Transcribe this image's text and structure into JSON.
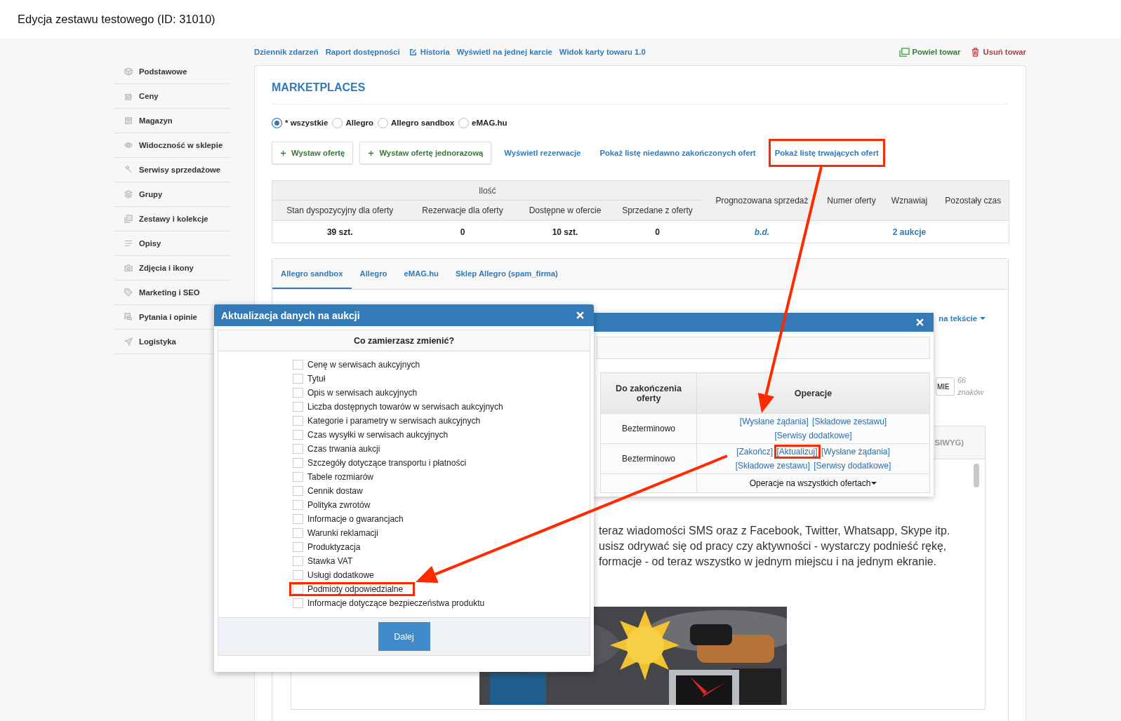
{
  "page": {
    "title": "Edycja zestawu testowego (ID: 31010)"
  },
  "sidebar": {
    "items": [
      {
        "label": "Podstawowe"
      },
      {
        "label": "Ceny"
      },
      {
        "label": "Magazyn"
      },
      {
        "label": "Widoczność w sklepie"
      },
      {
        "label": "Serwisy sprzedażowe"
      },
      {
        "label": "Grupy"
      },
      {
        "label": "Zestawy i kolekcje"
      },
      {
        "label": "Opisy"
      },
      {
        "label": "Zdjęcia i ikony"
      },
      {
        "label": "Marketing i SEO"
      },
      {
        "label": "Pytania i opinie"
      },
      {
        "label": "Logistyka"
      }
    ]
  },
  "top_links": [
    {
      "label": "Dziennik zdarzeń",
      "kind": "plain"
    },
    {
      "label": "Raport dostępności",
      "kind": "plain"
    },
    {
      "label": "Historia",
      "kind": "edit"
    },
    {
      "label": "Wyświetl na jednej karcie",
      "kind": "plain"
    },
    {
      "label": "Widok karty towaru 1.0",
      "kind": "plain"
    }
  ],
  "actions": [
    {
      "label": "Powiel towar",
      "kind": "copy"
    },
    {
      "label": "Usuń towar",
      "kind": "delete"
    }
  ],
  "marketplaces": {
    "heading": "MARKETPLACES",
    "filters": [
      {
        "label": "* wszystkie",
        "selected": true
      },
      {
        "label": "Allegro",
        "selected": false
      },
      {
        "label": "Allegro sandbox",
        "selected": false
      },
      {
        "label": "eMAG.hu",
        "selected": false
      }
    ],
    "buttons": [
      "Wystaw ofertę",
      "Wystaw ofertę jednorazową"
    ],
    "links": [
      {
        "label": "Wyświetl rezerwacje",
        "highlighted": false
      },
      {
        "label": "Pokaż listę niedawno zakończonych ofert",
        "highlighted": false
      },
      {
        "label": "Pokaż listę trwających ofert",
        "highlighted": true
      }
    ]
  },
  "stock_table": {
    "group": {
      "label": "Ilość",
      "columns": [
        {
          "header": "Stan dyspozycyjny dla oferty",
          "value": "39 szt.",
          "kind": "quantity"
        },
        {
          "header": "Rezerwacje dla oferty",
          "value": "0",
          "kind": "quantity"
        },
        {
          "header": "Dostępne w ofercie",
          "value": "10 szt.",
          "kind": "quantity"
        },
        {
          "header": "Sprzedane z oferty",
          "value": "0",
          "kind": "quantity"
        }
      ]
    },
    "columns": [
      {
        "header": "Prognozowana sprzedaż",
        "value": "b.d.",
        "kind": "estimate"
      },
      {
        "header": "Numer oferty"
      },
      {
        "header": "Wznawiaj",
        "value": "2 aukcje",
        "kind": "link"
      },
      {
        "header": "Pozostały czas"
      }
    ]
  },
  "tabs": [
    {
      "label": "Allegro sandbox",
      "selected": true
    },
    {
      "label": "Allegro",
      "selected": false
    },
    {
      "label": "eMAG.hu",
      "selected": false
    },
    {
      "label": "Sklep Allegro (spam_firma)",
      "selected": false
    }
  ],
  "editor": {
    "toggle": "na tekście",
    "name_field": "MIE",
    "counter": "66 znaków",
    "mode_tab": "SIWYG)",
    "paragraph": [
      "teraz wiadomości SMS oraz z Facebook, Twitter, Whatsapp, Skype itp.",
      "usisz odrywać się od pracy czy aktywności - wystarczy podnieść rękę,",
      "formacje - od teraz wszystko w jednym miejscu i na jednym ekranie."
    ],
    "image": {
      "kind": "picture"
    }
  },
  "offers_dialog": {
    "columns": [
      "Do zakończenia oferty",
      "Operacje"
    ],
    "rows": [
      {
        "end": "Bezterminowo",
        "operations": [
          {
            "label": "[Wysłane żądania]",
            "highlighted": false
          },
          {
            "label": "[Składowe zestawu]",
            "highlighted": false
          },
          {
            "label": "[Serwisy dodatkowe]",
            "highlighted": false
          }
        ]
      },
      {
        "end": "Bezterminowo",
        "operations": [
          {
            "label": "[Zakończ]",
            "highlighted": false
          },
          {
            "label": "[Aktualizuj]",
            "highlighted": true
          },
          {
            "label": "[Wysłane żądania]",
            "highlighted": false
          },
          {
            "label": "[Składowe zestawu]",
            "highlighted": false
          },
          {
            "label": "[Serwisy dodatkowe]",
            "highlighted": false
          }
        ]
      }
    ],
    "bulk": "Operacje na wszystkich ofertach"
  },
  "update_dialog": {
    "title": "Aktualizacja danych na aukcji",
    "question": "Co zamierzasz zmienić?",
    "options": [
      {
        "label": "Cenę w serwisach aukcyjnych",
        "checked": false,
        "highlighted": false
      },
      {
        "label": "Tytuł",
        "checked": false,
        "highlighted": false
      },
      {
        "label": "Opis w serwisach aukcyjnych",
        "checked": false,
        "highlighted": false
      },
      {
        "label": "Liczba dostępnych towarów w serwisach aukcyjnych",
        "checked": false,
        "highlighted": false
      },
      {
        "label": "Kategorie i parametry w serwisach aukcyjnych",
        "checked": false,
        "highlighted": false
      },
      {
        "label": "Czas wysyłki w serwisach aukcyjnych",
        "checked": false,
        "highlighted": false
      },
      {
        "label": "Czas trwania aukcji",
        "checked": false,
        "highlighted": false
      },
      {
        "label": "Szczegóły dotyczące transportu i płatności",
        "checked": false,
        "highlighted": false
      },
      {
        "label": "Tabele rozmiarów",
        "checked": false,
        "highlighted": false
      },
      {
        "label": "Cennik dostaw",
        "checked": false,
        "highlighted": false
      },
      {
        "label": "Polityka zwrotów",
        "checked": false,
        "highlighted": false
      },
      {
        "label": "Informacje o gwarancjach",
        "checked": false,
        "highlighted": false
      },
      {
        "label": "Warunki reklamacji",
        "checked": false,
        "highlighted": false
      },
      {
        "label": "Produktyzacja",
        "checked": false,
        "highlighted": false
      },
      {
        "label": "Stawka VAT",
        "checked": false,
        "highlighted": false
      },
      {
        "label": "Usługi dodatkowe",
        "checked": false,
        "highlighted": false
      },
      {
        "label": "Podmioty odpowiedzialne",
        "checked": false,
        "highlighted": true
      },
      {
        "label": "Informacje dotyczące bezpieczeństwa produktu",
        "checked": false,
        "highlighted": false
      }
    ],
    "button": "Dalej"
  }
}
